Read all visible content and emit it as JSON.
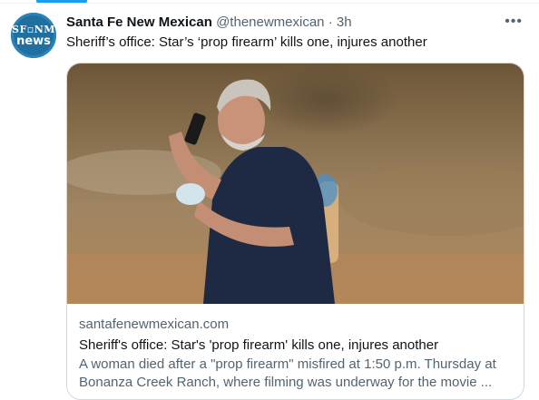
{
  "tweet": {
    "author_name": "Santa Fe New Mexican",
    "author_handle": "@thenewmexican",
    "separator": "·",
    "time": "3h",
    "text": "Sheriff’s office: Star’s ‘prop firearm’ kills one, injures another",
    "avatar": {
      "line1": "SF▫NM",
      "line2": "news"
    },
    "more_icon": "more-horizontal-icon"
  },
  "card": {
    "domain": "santafenewmexican.com",
    "title": "Sheriff's office: Star's 'prop firearm' kills one, injures another",
    "description": "A woman died after a \"prop firearm\" misfired at 1:50 p.m. Thursday at Bonanza Creek Ranch, where filming was underway for the movie ..."
  },
  "colors": {
    "accent": "#1d9bf0",
    "text": "#0f1419",
    "secondary": "#536471",
    "border": "#cfd9de"
  }
}
